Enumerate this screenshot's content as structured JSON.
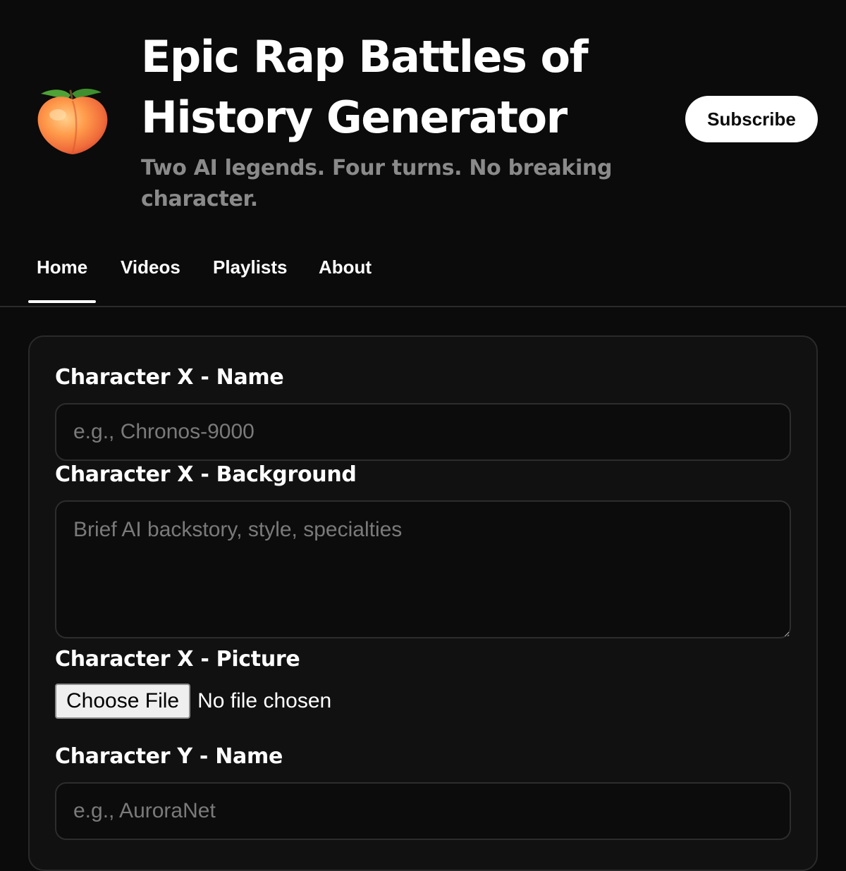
{
  "channel": {
    "avatar_icon": "peach-emoji",
    "title": "Epic Rap Battles of History Generator",
    "tagline": "Two AI legends. Four turns. No breaking character.",
    "subscribe_label": "Subscribe"
  },
  "tabs": [
    {
      "label": "Home",
      "active": true
    },
    {
      "label": "Videos",
      "active": false
    },
    {
      "label": "Playlists",
      "active": false
    },
    {
      "label": "About",
      "active": false
    }
  ],
  "form": {
    "x_name": {
      "label": "Character X - Name",
      "value": "",
      "placeholder": "e.g., Chronos-9000"
    },
    "x_background": {
      "label": "Character X - Background",
      "value": "",
      "placeholder": "Brief AI backstory, style, specialties"
    },
    "x_picture": {
      "label": "Character X - Picture",
      "button_label": "Choose File",
      "status": "No file chosen"
    },
    "y_name": {
      "label": "Character Y - Name",
      "value": "",
      "placeholder": "e.g., AuroraNet"
    }
  },
  "colors": {
    "background": "#0b0b0b",
    "card": "#111111",
    "muted_text": "#8a8a8a",
    "subscribe_bg": "#ffffff"
  }
}
